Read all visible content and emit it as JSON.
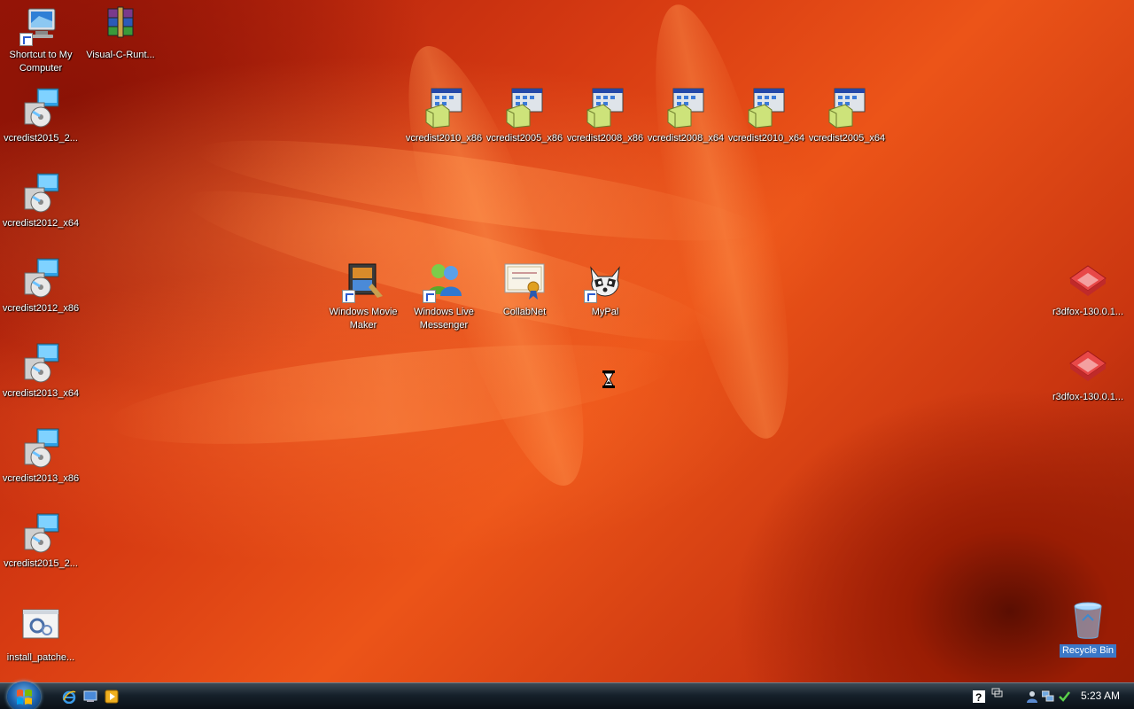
{
  "desktop": {
    "icons": {
      "my_computer": "Shortcut to My Computer",
      "visual_c_runtime": "Visual-C-Runt...",
      "vcredist2015_a": "vcredist2015_2...",
      "vcredist2012_x64": "vcredist2012_x64",
      "vcredist2012_x86": "vcredist2012_x86",
      "vcredist2013_x64": "vcredist2013_x64",
      "vcredist2013_x86": "vcredist2013_x86",
      "vcredist2015_b": "vcredist2015_2...",
      "install_patches": "install_patche...",
      "vcredist2010_x86": "vcredist2010_x86",
      "vcredist2005_x86": "vcredist2005_x86",
      "vcredist2008_x86": "vcredist2008_x86",
      "vcredist2008_x64": "vcredist2008_x64",
      "vcredist2010_x64": "vcredist2010_x64",
      "vcredist2005_x64": "vcredist2005_x64",
      "windows_movie_maker": "Windows Movie Maker",
      "windows_live_messenger": "Windows Live Messenger",
      "collabnet": "CollabNet",
      "mypal": "MyPal",
      "r3dfox_a": "r3dfox-130.0.1...",
      "r3dfox_b": "r3dfox-130.0.1...",
      "recycle_bin": "Recycle Bin"
    }
  },
  "taskbar": {
    "clock": "5:23 AM"
  },
  "colors": {
    "selection": "#3b78c8",
    "taskbar": "#15202a"
  }
}
